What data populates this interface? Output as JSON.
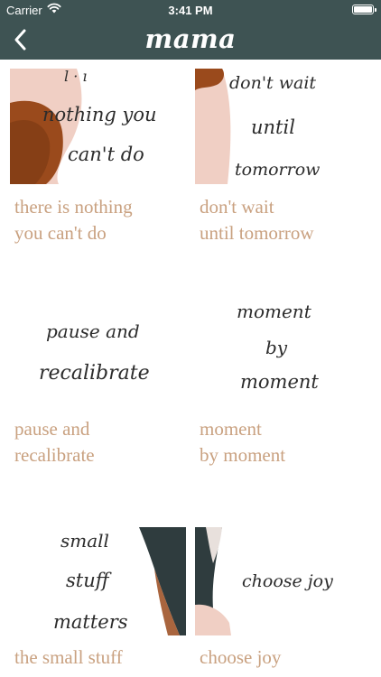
{
  "status_bar": {
    "carrier": "Carrier",
    "time": "3:41 PM",
    "battery_level": 1.0,
    "icons": [
      "wifi-icon",
      "battery-icon"
    ]
  },
  "nav_bar": {
    "title": "mama",
    "back_icon": "chevron-left-icon"
  },
  "colors": {
    "nav_background": "#3e5353",
    "caption_text": "#c9a180",
    "script_text": "#2c2c2c",
    "blush": "#f0cfc4",
    "rust": "#9a4a1c",
    "slate": "#2f3c3e"
  },
  "cards": [
    {
      "art_text": [
        "nothing you",
        "can't do"
      ],
      "caption_lines": [
        "there is nothing",
        "you can't do"
      ]
    },
    {
      "art_text": [
        "don't wait",
        "until",
        "tomorrow"
      ],
      "caption_lines": [
        "don't wait",
        "until tomorrow"
      ]
    },
    {
      "art_text": [
        "pause and",
        "recalibrate"
      ],
      "caption_lines": [
        "pause and",
        "recalibrate"
      ]
    },
    {
      "art_text": [
        "moment",
        "by",
        "moment"
      ],
      "caption_lines": [
        "moment",
        "by moment"
      ]
    },
    {
      "art_text": [
        "small",
        "stuff",
        "matters"
      ],
      "caption_lines": [
        "the small stuff"
      ]
    },
    {
      "art_text": [
        "choose joy"
      ],
      "caption_lines": [
        "choose joy"
      ]
    }
  ]
}
